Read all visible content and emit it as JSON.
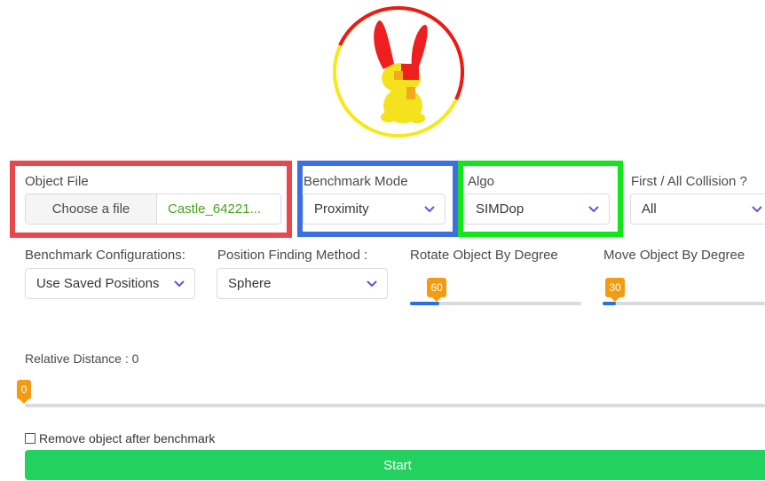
{
  "object_file": {
    "label": "Object File",
    "button_label": "Choose a file",
    "file_name": "Castle_64221..."
  },
  "benchmark_mode": {
    "label": "Benchmark Mode",
    "value": "Proximity"
  },
  "algo": {
    "label": "Algo",
    "value": "SIMDop"
  },
  "collision": {
    "label": "First / All Collision ?",
    "value": "All"
  },
  "benchmark_config": {
    "label": "Benchmark Configurations:",
    "value": "Use Saved Positions"
  },
  "position_method": {
    "label": "Position Finding Method :",
    "value": "Sphere"
  },
  "rotate": {
    "label": "Rotate Object By Degree",
    "value": "60",
    "fraction": 0.17
  },
  "move": {
    "label": "Move Object By Degree",
    "value": "30",
    "fraction": 0.08
  },
  "relative_distance": {
    "label": "Relative Distance : 0",
    "value": "0",
    "fraction": 0.0
  },
  "remove_object": {
    "label": "Remove object after benchmark",
    "checked": false
  },
  "start_button": {
    "label": "Start"
  },
  "colors": {
    "highlight_red": "#e8474c",
    "highlight_blue": "#3d6fe0",
    "highlight_green": "#13e51b",
    "accent_purple": "#6c4ce0",
    "slider_fill": "#2f6fdb",
    "tooltip_orange": "#f39c12",
    "start_green": "#23d160",
    "file_name_green": "#48a11d"
  }
}
